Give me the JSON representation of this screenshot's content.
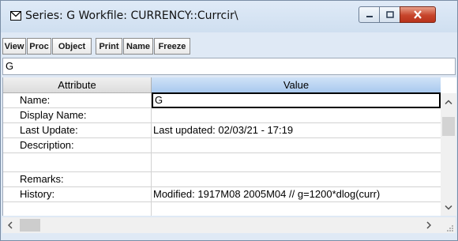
{
  "window": {
    "title": "Series: G   Workfile: CURRENCY::Currcir\\",
    "icon": "series-icon"
  },
  "toolbar": {
    "buttons": [
      "View",
      "Proc",
      "Object",
      "Print",
      "Name",
      "Freeze"
    ]
  },
  "name_bar": {
    "value": "G"
  },
  "table": {
    "columns": [
      "Attribute",
      "Value"
    ],
    "rows": [
      {
        "attribute": "Name:",
        "value": "G"
      },
      {
        "attribute": "Display Name:",
        "value": ""
      },
      {
        "attribute": "Last Update:",
        "value": "Last updated: 02/03/21 - 17:19"
      },
      {
        "attribute": "Description:",
        "value": ""
      },
      {
        "attribute": "",
        "value": ""
      },
      {
        "attribute": "Remarks:",
        "value": ""
      },
      {
        "attribute": "History:",
        "value": "Modified: 1917M08 2005M04 // g=1200*dlog(curr)"
      }
    ]
  },
  "colors": {
    "title_bar": "#dfeaf7",
    "value_header": "#a9c9ee",
    "close_button": "#c7452b"
  }
}
